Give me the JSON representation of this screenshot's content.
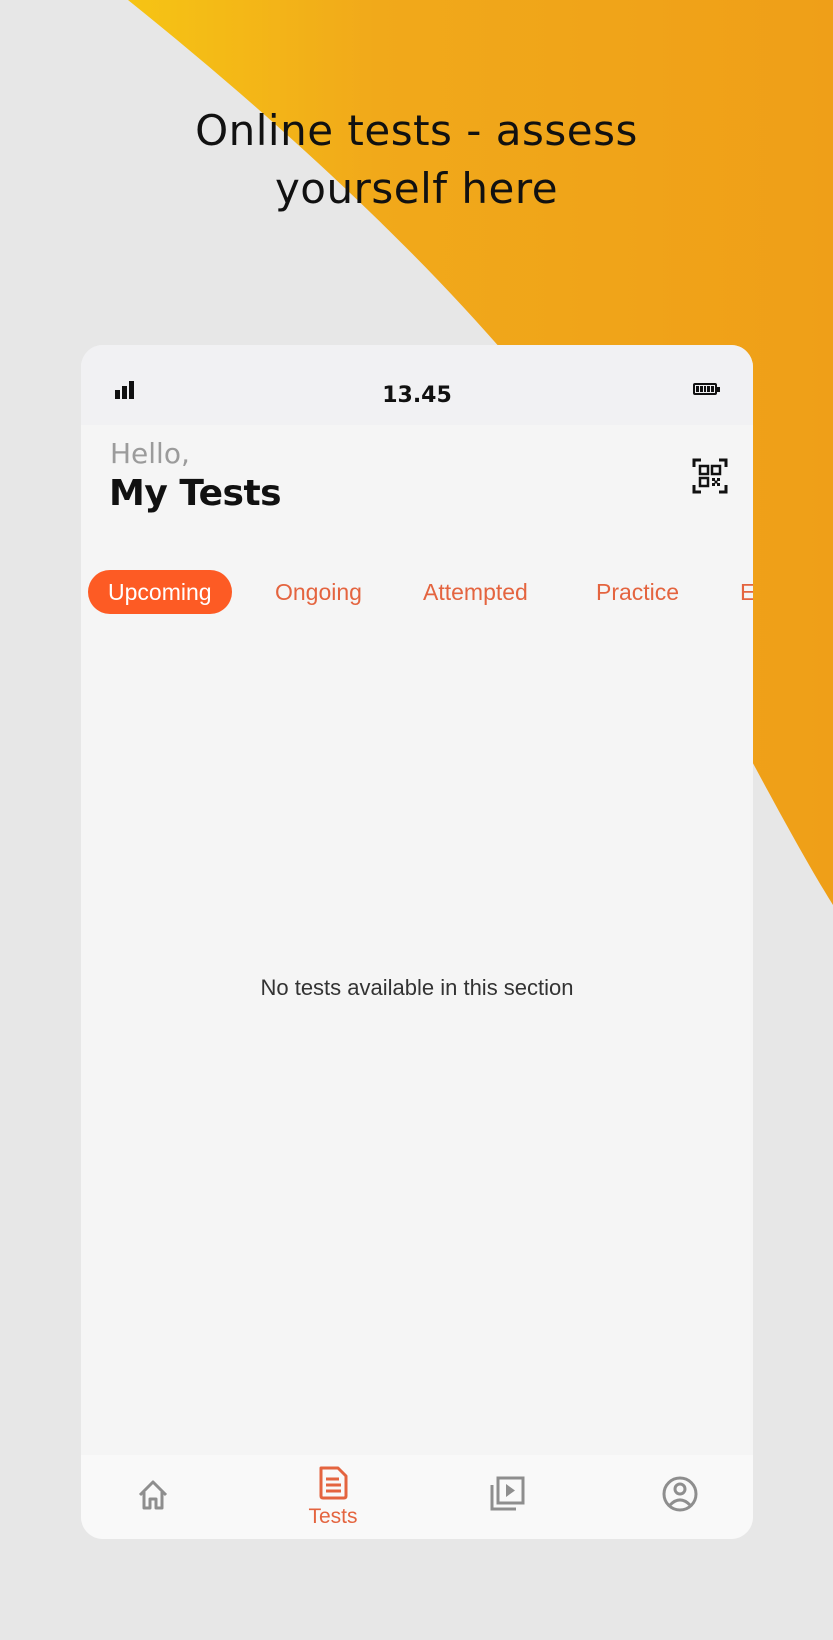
{
  "promo": {
    "headline_line1": "Online tests - assess",
    "headline_line2": "yourself here"
  },
  "colors": {
    "accent": "#fd5b24",
    "accent_text": "#e4643f",
    "promo_orange": "#f0a418",
    "promo_yellow": "#f4bb16",
    "background": "#e6e6e6",
    "icon_gray": "#8e8e8e"
  },
  "status_bar": {
    "time": "13.45",
    "signal_icon": "signal-bars-icon",
    "battery_icon": "battery-full-icon"
  },
  "header": {
    "greeting": "Hello,",
    "title": "My Tests",
    "qr_icon": "qr-scan-icon"
  },
  "tabs": [
    {
      "label": "Upcoming",
      "active": true
    },
    {
      "label": "Ongoing",
      "active": false
    },
    {
      "label": "Attempted",
      "active": false
    },
    {
      "label": "Practice",
      "active": false
    },
    {
      "label": "E",
      "active": false
    }
  ],
  "empty_state": {
    "message": "No tests available in this section"
  },
  "bottom_nav": [
    {
      "name": "home",
      "icon": "home-icon",
      "label": "",
      "active": false
    },
    {
      "name": "tests",
      "icon": "document-icon",
      "label": "Tests",
      "active": true
    },
    {
      "name": "videos",
      "icon": "video-library-icon",
      "label": "",
      "active": false
    },
    {
      "name": "profile",
      "icon": "profile-icon",
      "label": "",
      "active": false
    }
  ]
}
